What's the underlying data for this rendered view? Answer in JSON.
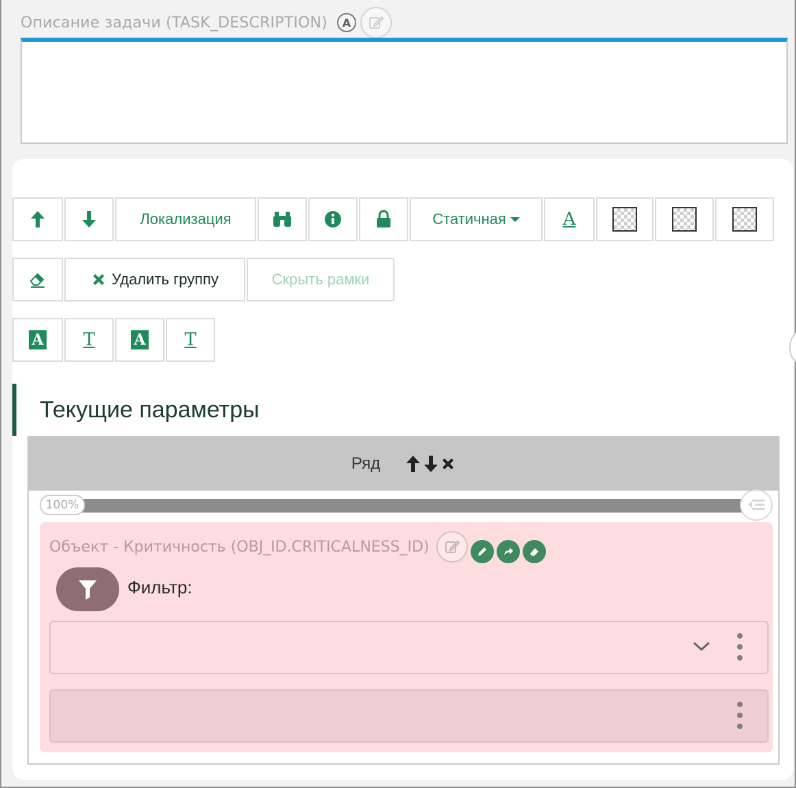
{
  "description_field": {
    "label": "Описание задачи (TASK_DESCRIPTION)",
    "badge": "A",
    "value": ""
  },
  "toolbar_row1": {
    "up_icon": "arrow-up-icon",
    "down_icon": "arrow-down-icon",
    "localization_label": "Локализация",
    "binoculars_icon": "binoculars-icon",
    "info_icon": "info-icon",
    "lock_icon": "lock-icon",
    "static_label": "Статичная",
    "font_color_glyph": "A"
  },
  "toolbar_row2": {
    "eraser_icon": "eraser-icon",
    "delete_group_label": "Удалить группу",
    "hide_frames_label": "Скрыть рамки"
  },
  "toolbar_row3": {
    "glyphs": [
      "A",
      "T",
      "A",
      "T"
    ]
  },
  "section": {
    "title": "Текущие параметры"
  },
  "row": {
    "label": "Ряд",
    "width_label": "100%",
    "width_percent": 100
  },
  "object_field": {
    "label": "Объект - Критичность (OBJ_ID.CRITICALNESS_ID)",
    "filter_label": "Фильтр:",
    "select_value": "",
    "second_value": ""
  },
  "colors": {
    "accent_green": "#1f8a5c",
    "blue_border": "#1f97d3",
    "card_pink": "#fddde0",
    "filter_button": "#8f6e72"
  }
}
